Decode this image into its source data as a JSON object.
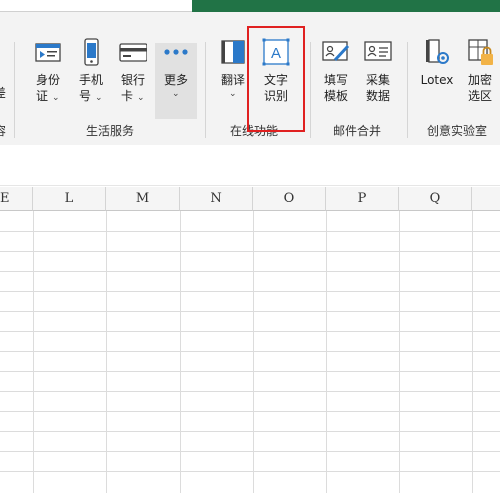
{
  "ribbon": {
    "groups": [
      {
        "label": "生活服务",
        "items": [
          {
            "line1": "身份",
            "line2": "证",
            "icon": "id-card-icon"
          },
          {
            "line1": "手机",
            "line2": "号",
            "icon": "phone-icon"
          },
          {
            "line1": "银行",
            "line2": "卡",
            "icon": "bank-card-icon"
          },
          {
            "line1": "更多",
            "line2": "",
            "icon": "more-dots-icon"
          }
        ]
      },
      {
        "label": "在线功能",
        "items": [
          {
            "line1": "翻译",
            "line2": "",
            "icon": "translate-icon"
          },
          {
            "line1": "文字",
            "line2": "识别",
            "icon": "text-recognition-icon"
          }
        ]
      },
      {
        "label": "邮件合并",
        "items": [
          {
            "line1": "填写",
            "line2": "模板",
            "icon": "fill-template-icon"
          },
          {
            "line1": "采集",
            "line2": "数据",
            "icon": "collect-data-icon"
          }
        ]
      },
      {
        "label": "创意实验室",
        "items": [
          {
            "line1": "Lotex",
            "line2": "",
            "icon": "lotex-icon"
          },
          {
            "line1": "加密",
            "line2": "选区",
            "icon": "encrypt-selection-icon"
          }
        ]
      }
    ],
    "left_partial": {
      "line1": "差",
      "group_label": "容"
    },
    "chevron": "⌄"
  },
  "columns": [
    "E",
    "L",
    "M",
    "N",
    "O",
    "P",
    "Q"
  ],
  "colors": {
    "accent": "#217346",
    "highlight": "#e02020"
  }
}
